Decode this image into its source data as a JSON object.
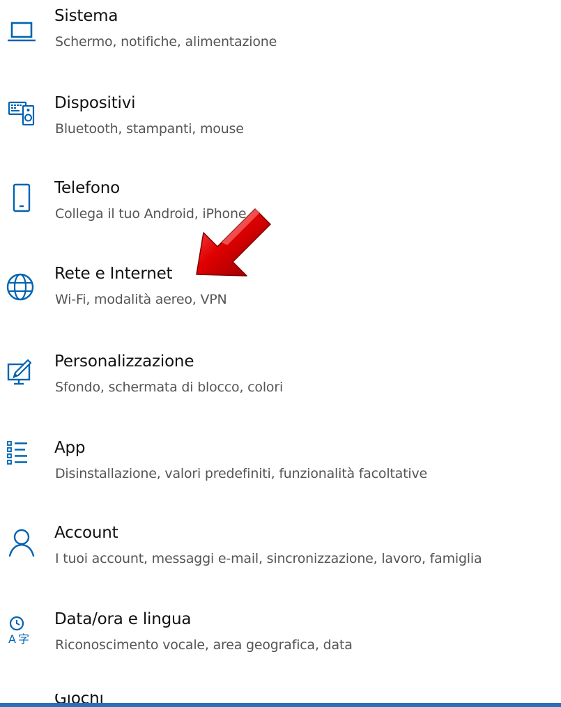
{
  "accent_color": "#0063b1",
  "items": [
    {
      "title": "Sistema",
      "subtitle": "Schermo, notifiche, alimentazione",
      "icon": "laptop-icon"
    },
    {
      "title": "Dispositivi",
      "subtitle": "Bluetooth, stampanti, mouse",
      "icon": "devices-icon"
    },
    {
      "title": "Telefono",
      "subtitle": "Collega il tuo Android, iPhone",
      "icon": "phone-icon"
    },
    {
      "title": "Rete e Internet",
      "subtitle": "Wi-Fi, modalità aereo, VPN",
      "icon": "globe-icon"
    },
    {
      "title": "Personalizzazione",
      "subtitle": "Sfondo, schermata di blocco, colori",
      "icon": "personalization-icon"
    },
    {
      "title": "App",
      "subtitle": "Disinstallazione, valori predefiniti, funzionalità facoltative",
      "icon": "apps-list-icon"
    },
    {
      "title": "Account",
      "subtitle": "I tuoi account, messaggi e-mail, sincronizzazione, lavoro, famiglia",
      "icon": "account-icon"
    },
    {
      "title": "Data/ora e lingua",
      "subtitle": "Riconoscimento vocale, area geografica, data",
      "icon": "time-language-icon"
    },
    {
      "title": "Giochi",
      "icon": "gaming-icon"
    }
  ],
  "annotation": {
    "icon": "red-arrow-icon"
  }
}
